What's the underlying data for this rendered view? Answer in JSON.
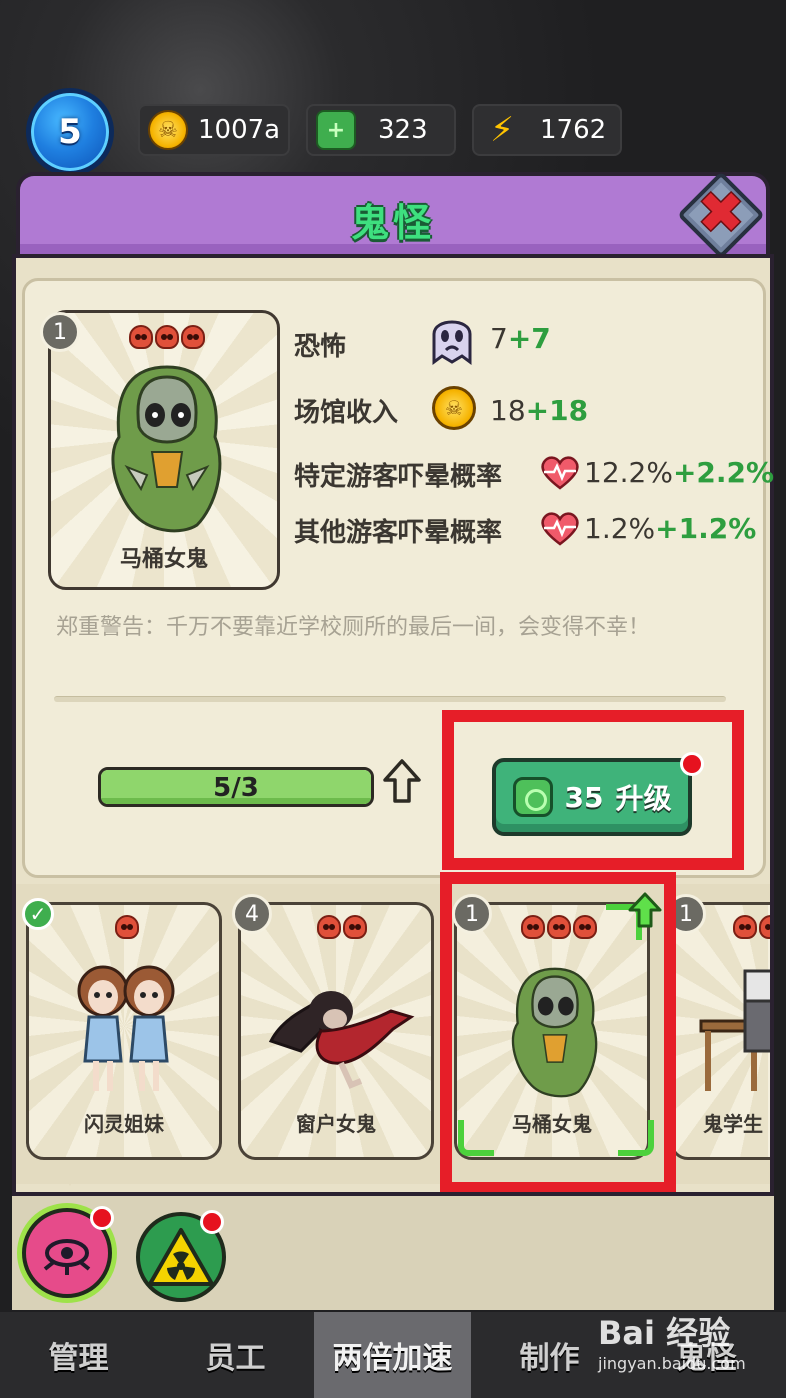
{
  "top_bar": {
    "level": "5",
    "coins": "1007a",
    "gems": "323",
    "energy": "1762"
  },
  "panel": {
    "title": "鬼怪",
    "close_icon": "close-x-icon"
  },
  "ghost_detail": {
    "level": "1",
    "skull_count": 3,
    "name": "马桶女鬼",
    "stats": [
      {
        "label": "恐怖",
        "base": "7",
        "bonus": "+7",
        "icon": "ghost-face-icon"
      },
      {
        "label": "场馆收入",
        "base": "18",
        "bonus": "+18",
        "icon": "coin-icon"
      },
      {
        "label": "特定游客吓晕概率",
        "base": "12.2%",
        "bonus": "+2.2%",
        "icon": "heartbeat-icon"
      },
      {
        "label": "其他游客吓晕概率",
        "base": "1.2%",
        "bonus": "+1.2%",
        "icon": "heartbeat-icon"
      }
    ],
    "description": "郑重警告：千万不要靠近学校厕所的最后一间，会变得不幸！",
    "progress": {
      "text": "5/3",
      "fraction": 1.0
    },
    "upgrade": {
      "cost": "35",
      "label": "升级"
    }
  },
  "roster": [
    {
      "name": "闪灵姐妹",
      "level": "",
      "skulls": 1,
      "owned_check": true
    },
    {
      "name": "窗户女鬼",
      "level": "4",
      "skulls": 2
    },
    {
      "name": "马桶女鬼",
      "level": "1",
      "skulls": 3,
      "selected": true
    },
    {
      "name": "鬼学生",
      "level": "1",
      "skulls": 2
    }
  ],
  "category_tabs": [
    {
      "icon": "eye-claw-icon",
      "color": "#e64b8a"
    },
    {
      "icon": "radiation-icon",
      "color": "#f5d300"
    }
  ],
  "bottom_nav": [
    "管理",
    "员工",
    "两倍加速",
    "制作",
    "鬼怪"
  ],
  "watermark": {
    "brand": "Bai 经验",
    "url": "jingyan.baidu.com"
  },
  "colors": {
    "accent_green": "#3fb37a",
    "header_purple": "#b07ad3",
    "highlight_red": "#e61e28",
    "bonus_green": "#2e9e3f"
  }
}
